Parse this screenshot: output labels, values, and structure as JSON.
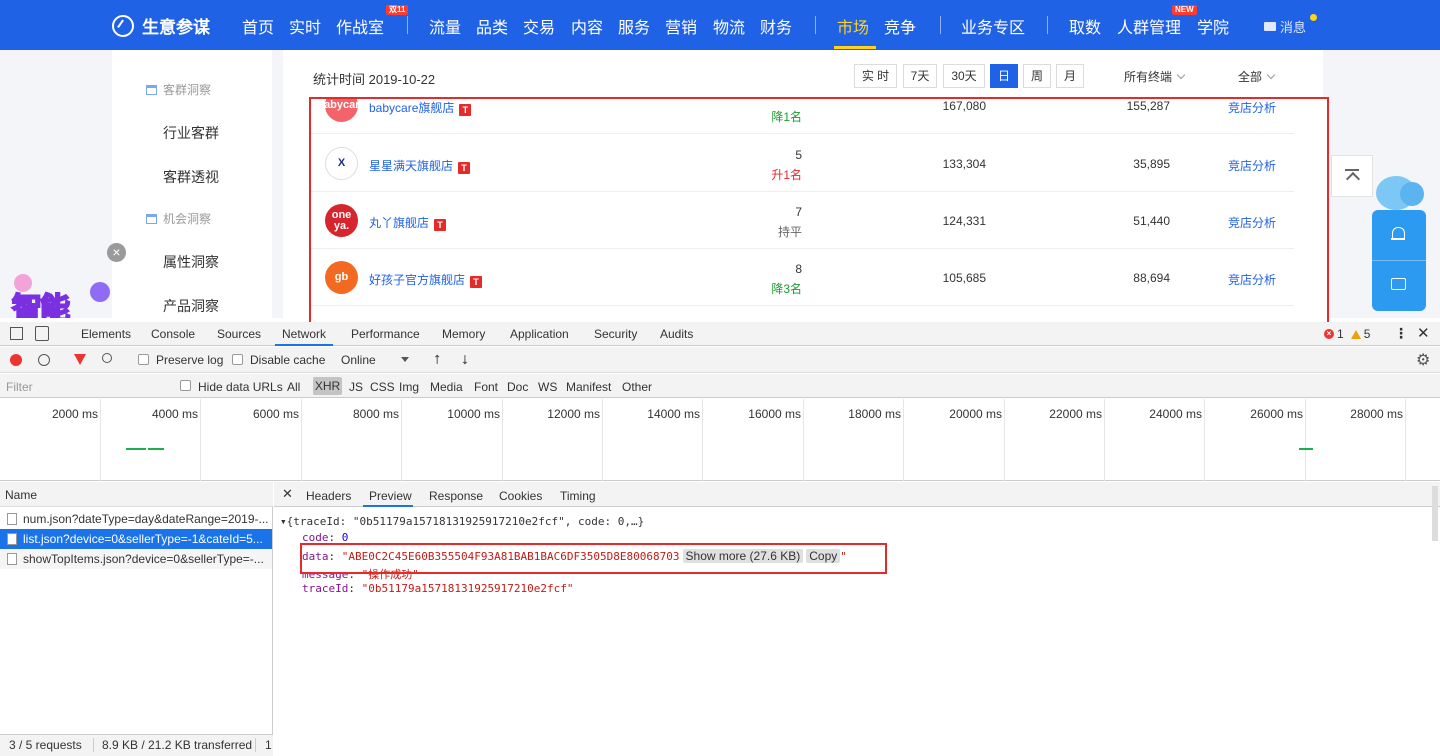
{
  "topnav": {
    "brand": "生意参谋",
    "items": [
      "首页",
      "实时",
      "作战室",
      "流量",
      "品类",
      "交易",
      "内容",
      "服务",
      "营销",
      "物流",
      "财务",
      "市场",
      "竞争",
      "业务专区",
      "取数",
      "人群管理",
      "学院"
    ],
    "badge_shuang11": "双11",
    "badge_new": "NEW",
    "active": "市场",
    "message": "消息"
  },
  "sidebar": {
    "section1": "客群洞察",
    "item1": "行业客群",
    "item2": "客群透视",
    "section2": "机会洞察",
    "item3": "属性洞察",
    "item4": "产品洞察",
    "banner": "智能"
  },
  "filter": {
    "stat_time": "统计时间 2019-10-22",
    "buttons": [
      "实 时",
      "7天",
      "30天",
      "日",
      "周",
      "月"
    ],
    "active_button": "日",
    "terminal": "所有终端",
    "scope": "全部"
  },
  "rows": [
    {
      "logo": "babycare",
      "name": "babycare旗舰店",
      "rank": "",
      "change": "降1名",
      "change_color": "#1a9e2e",
      "v1": "167,080",
      "v2": "155,287",
      "link": "竞店分析",
      "logo_color": "#f2646a"
    },
    {
      "logo": "X",
      "name": "星星满天旗舰店",
      "rank": "5",
      "change": "升1名",
      "change_color": "#e52a2a",
      "v1": "133,304",
      "v2": "35,895",
      "link": "竞店分析",
      "logo_color": "#ffffff"
    },
    {
      "logo": "one ya.",
      "name": "丸丫旗舰店",
      "rank": "7",
      "change": "持平",
      "change_color": "#666666",
      "v1": "124,331",
      "v2": "51,440",
      "link": "竞店分析",
      "logo_color": "#d8242c"
    },
    {
      "logo": "gb",
      "name": "好孩子官方旗舰店",
      "rank": "8",
      "change": "降3名",
      "change_color": "#1a9e2e",
      "v1": "105,685",
      "v2": "88,694",
      "link": "竞店分析",
      "logo_color": "#f26a21"
    }
  ],
  "devtools": {
    "tabs": [
      "Elements",
      "Console",
      "Sources",
      "Network",
      "Performance",
      "Memory",
      "Application",
      "Security",
      "Audits"
    ],
    "active_tab": "Network",
    "errors": "1",
    "warnings": "5",
    "toolbar": {
      "preserve_log": "Preserve log",
      "disable_cache": "Disable cache",
      "throttle": "Online"
    },
    "filter": {
      "placeholder": "Filter",
      "hide_data": "Hide data URLs",
      "types": [
        "All",
        "XHR",
        "JS",
        "CSS",
        "Img",
        "Media",
        "Font",
        "Doc",
        "WS",
        "Manifest",
        "Other"
      ]
    },
    "timeline": [
      "2000 ms",
      "4000 ms",
      "6000 ms",
      "8000 ms",
      "10000 ms",
      "12000 ms",
      "14000 ms",
      "16000 ms",
      "18000 ms",
      "20000 ms",
      "22000 ms",
      "24000 ms",
      "26000 ms",
      "28000 ms"
    ],
    "name_header": "Name",
    "requests": [
      "num.json?dateType=day&dateRange=2019-...",
      "list.json?device=0&sellerType=-1&cateId=5...",
      "showTopItems.json?device=0&sellerType=-..."
    ],
    "status": "3 / 5 requests",
    "transferred": "8.9 KB / 21.2 KB transferred",
    "status_extra": "1",
    "detail_tabs": [
      "Headers",
      "Preview",
      "Response",
      "Cookies",
      "Timing"
    ],
    "active_detail": "Preview",
    "preview": {
      "root": "{traceId: \"0b51179a15718131925917210e2fcf\", code: 0,…}",
      "code_key": "code",
      "code_val": "0",
      "data_key": "data",
      "data_val": "\"ABE0C2C45E60B355504F93A81BAB1BAC6DF3505D8E80068703",
      "show_more": "Show more (27.6 KB)",
      "copy": "Copy",
      "quote": "\"",
      "message_key": "message",
      "message_val": "\"操作成功\"",
      "trace_key": "traceId",
      "trace_val": "\"0b51179a15718131925917210e2fcf\""
    }
  }
}
